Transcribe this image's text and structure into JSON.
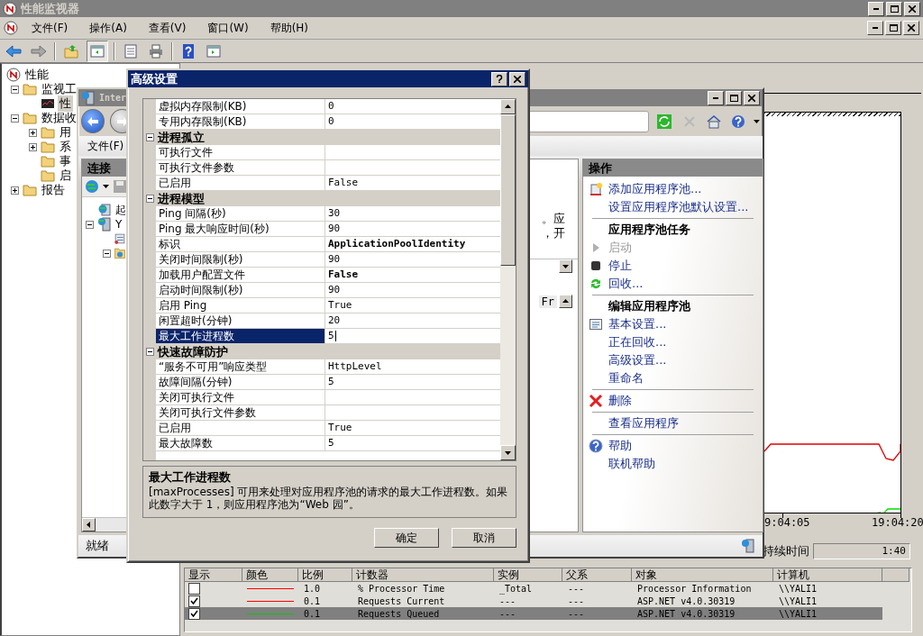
{
  "main_window": {
    "title": "性能监视器",
    "menu": [
      "文件(F)",
      "操作(A)",
      "查看(V)",
      "窗口(W)",
      "帮助(H)"
    ]
  },
  "tree": [
    {
      "label": "性能",
      "kind": "root",
      "selected": false,
      "children": [
        {
          "label": "监视工",
          "kind": "folder",
          "selected": false,
          "expanded": true,
          "children": [
            {
              "label": "性",
              "kind": "monitor",
              "selected": true
            }
          ]
        },
        {
          "label": "数据收",
          "kind": "folder",
          "selected": false,
          "expanded": true,
          "children": [
            {
              "label": "用",
              "kind": "folder",
              "selected": false,
              "expanded": false
            },
            {
              "label": "系",
              "kind": "folder",
              "selected": false,
              "expanded": false
            },
            {
              "label": "事",
              "kind": "folder",
              "selected": false
            },
            {
              "label": "启",
              "kind": "folder",
              "selected": false
            }
          ]
        },
        {
          "label": "报告",
          "kind": "folder",
          "selected": false,
          "expanded": false
        }
      ]
    }
  ],
  "graph": {
    "time_labels": [
      "9:04:05",
      "19:04:20"
    ],
    "duration_label": "持续时间",
    "duration_value": "1:40"
  },
  "counters": {
    "columns": [
      "显示",
      "颜色",
      "比例",
      "计数器",
      "实例",
      "父系",
      "对象",
      "计算机"
    ],
    "rows": [
      {
        "checked": false,
        "selected": false,
        "color": "#ff0000",
        "scale": "1.0",
        "counter": "% Processor Time",
        "instance": "_Total",
        "parent": "---",
        "object": "Processor Information",
        "computer": "\\\\YALI1"
      },
      {
        "checked": true,
        "selected": false,
        "color": "#ff0000",
        "scale": "0.1",
        "counter": "Requests Current",
        "instance": "---",
        "parent": "---",
        "object": "ASP.NET v4.0.30319",
        "computer": "\\\\YALI1"
      },
      {
        "checked": true,
        "selected": true,
        "color": "#00cc00",
        "scale": "0.1",
        "counter": "Requests Queued",
        "instance": "---",
        "parent": "---",
        "object": "ASP.NET v4.0.30319",
        "computer": "\\\\YALI1"
      }
    ]
  },
  "iis_window": {
    "title": "Inter",
    "menu": [
      "文件(F)"
    ],
    "connections": {
      "title": "连接",
      "items": [
        {
          "label": "起",
          "kind": "start"
        },
        {
          "label": "Y",
          "kind": "server",
          "expanded": true,
          "children": [
            {
              "kind": "pools"
            },
            {
              "kind": "sites",
              "expanded": true
            }
          ]
        }
      ]
    },
    "content_fragments": [
      "。应",
      "，开"
    ],
    "list_header": "Fr",
    "actions": {
      "title": "操作",
      "items": [
        {
          "kind": "link",
          "label": "添加应用程序池...",
          "disabled": false
        },
        {
          "kind": "link",
          "label": "设置应用程序池默认设置...",
          "disabled": false
        },
        {
          "kind": "separator"
        },
        {
          "kind": "header",
          "label": "应用程序池任务"
        },
        {
          "kind": "link",
          "label": "启动",
          "disabled": true
        },
        {
          "kind": "link",
          "label": "停止",
          "disabled": false
        },
        {
          "kind": "link",
          "label": "回收...",
          "disabled": false
        },
        {
          "kind": "separator"
        },
        {
          "kind": "header",
          "label": "编辑应用程序池"
        },
        {
          "kind": "link",
          "label": "基本设置...",
          "disabled": false
        },
        {
          "kind": "link",
          "label": "正在回收...",
          "disabled": false
        },
        {
          "kind": "link",
          "label": "高级设置...",
          "disabled": false
        },
        {
          "kind": "link",
          "label": "重命名",
          "disabled": false
        },
        {
          "kind": "separator"
        },
        {
          "kind": "link",
          "label": "删除",
          "disabled": false
        },
        {
          "kind": "separator"
        },
        {
          "kind": "link",
          "label": "查看应用程序",
          "disabled": false
        },
        {
          "kind": "separator"
        },
        {
          "kind": "link",
          "label": "帮助",
          "disabled": false
        },
        {
          "kind": "link",
          "label": "联机帮助",
          "disabled": false
        }
      ]
    },
    "status": "就绪"
  },
  "dialog": {
    "title": "高级设置",
    "properties": [
      {
        "kind": "property",
        "name": "虚拟内存限制(KB)",
        "value": "0",
        "modified": false,
        "selected": false
      },
      {
        "kind": "property",
        "name": "专用内存限制(KB)",
        "value": "0",
        "modified": false,
        "selected": false
      },
      {
        "kind": "category",
        "name": "进程孤立",
        "expanded": true
      },
      {
        "kind": "property",
        "name": "可执行文件",
        "modified": false,
        "selected": false
      },
      {
        "kind": "property",
        "name": "可执行文件参数",
        "modified": false,
        "selected": false
      },
      {
        "kind": "property",
        "name": "已启用",
        "value": "False",
        "modified": false,
        "selected": false
      },
      {
        "kind": "category",
        "name": "进程模型",
        "expanded": true
      },
      {
        "kind": "property",
        "name": "Ping 间隔(秒)",
        "value": "30",
        "modified": false,
        "selected": false
      },
      {
        "kind": "property",
        "name": "Ping 最大响应时间(秒)",
        "value": "90",
        "modified": false,
        "selected": false
      },
      {
        "kind": "property",
        "name": "标识",
        "value": "ApplicationPoolIdentity",
        "modified": true,
        "selected": false
      },
      {
        "kind": "property",
        "name": "关闭时间限制(秒)",
        "value": "90",
        "modified": false,
        "selected": false
      },
      {
        "kind": "property",
        "name": "加载用户配置文件",
        "value": "False",
        "modified": true,
        "selected": false
      },
      {
        "kind": "property",
        "name": "启动时间限制(秒)",
        "value": "90",
        "modified": false,
        "selected": false
      },
      {
        "kind": "property",
        "name": "启用 Ping",
        "value": "True",
        "modified": false,
        "selected": false
      },
      {
        "kind": "property",
        "name": "闲置超时(分钟)",
        "value": "20",
        "modified": false,
        "selected": false
      },
      {
        "kind": "property",
        "name": "最大工作进程数",
        "value": "5",
        "modified": false,
        "selected": true
      },
      {
        "kind": "category",
        "name": "快速故障防护",
        "expanded": true
      },
      {
        "kind": "property",
        "name": "“服务不可用”响应类型",
        "value": "HttpLevel",
        "modified": false,
        "selected": false
      },
      {
        "kind": "property",
        "name": "故障间隔(分钟)",
        "value": "5",
        "modified": false,
        "selected": false
      },
      {
        "kind": "property",
        "name": "关闭可执行文件",
        "modified": false,
        "selected": false
      },
      {
        "kind": "property",
        "name": "关闭可执行文件参数",
        "modified": false,
        "selected": false
      },
      {
        "kind": "property",
        "name": "已启用",
        "value": "True",
        "modified": false,
        "selected": false
      },
      {
        "kind": "property",
        "name": "最大故障数",
        "value": "5",
        "modified": false,
        "selected": false
      }
    ],
    "description": {
      "title": "最大工作进程数",
      "text": "[maxProcesses] 可用来处理对应用程序池的请求的最大工作进程数。如果此数字大于 1，则应用程序池为“Web 园”。"
    },
    "buttons": [
      "确定",
      "取消"
    ]
  }
}
